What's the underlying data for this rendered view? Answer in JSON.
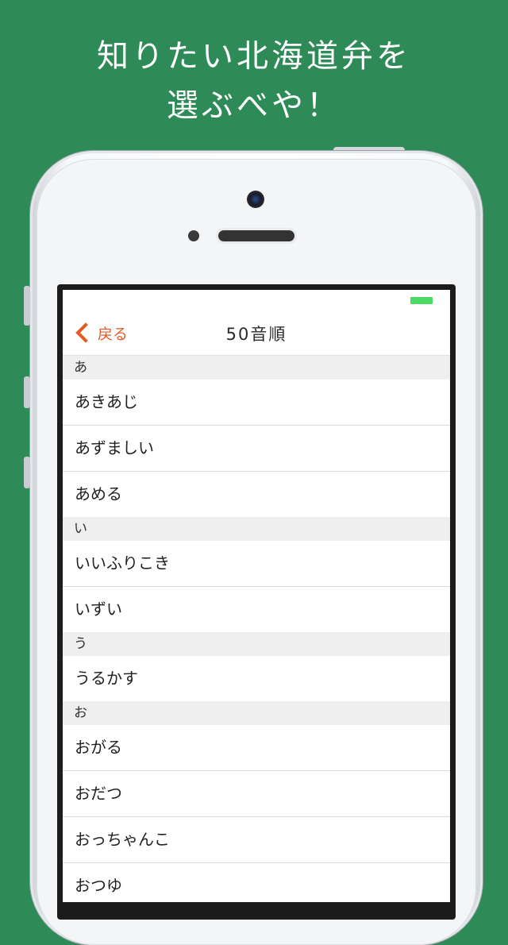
{
  "promo": {
    "line1": "知りたい北海道弁を",
    "line2": "選ぶべや！"
  },
  "colors": {
    "background": "#2e8b57",
    "accent": "#e35a27",
    "battery": "#4cd964"
  },
  "nav": {
    "back_label": "戻る",
    "back_icon": "chevron-left-icon",
    "title": "50音順"
  },
  "sections": [
    {
      "header": "あ",
      "items": [
        "あきあじ",
        "あずましい",
        "あめる"
      ]
    },
    {
      "header": "い",
      "items": [
        "いいふりこき",
        "いずい"
      ]
    },
    {
      "header": "う",
      "items": [
        "うるかす"
      ]
    },
    {
      "header": "お",
      "items": [
        "おがる",
        "おだつ",
        "おっちゃんこ",
        "おつゆ"
      ]
    }
  ]
}
